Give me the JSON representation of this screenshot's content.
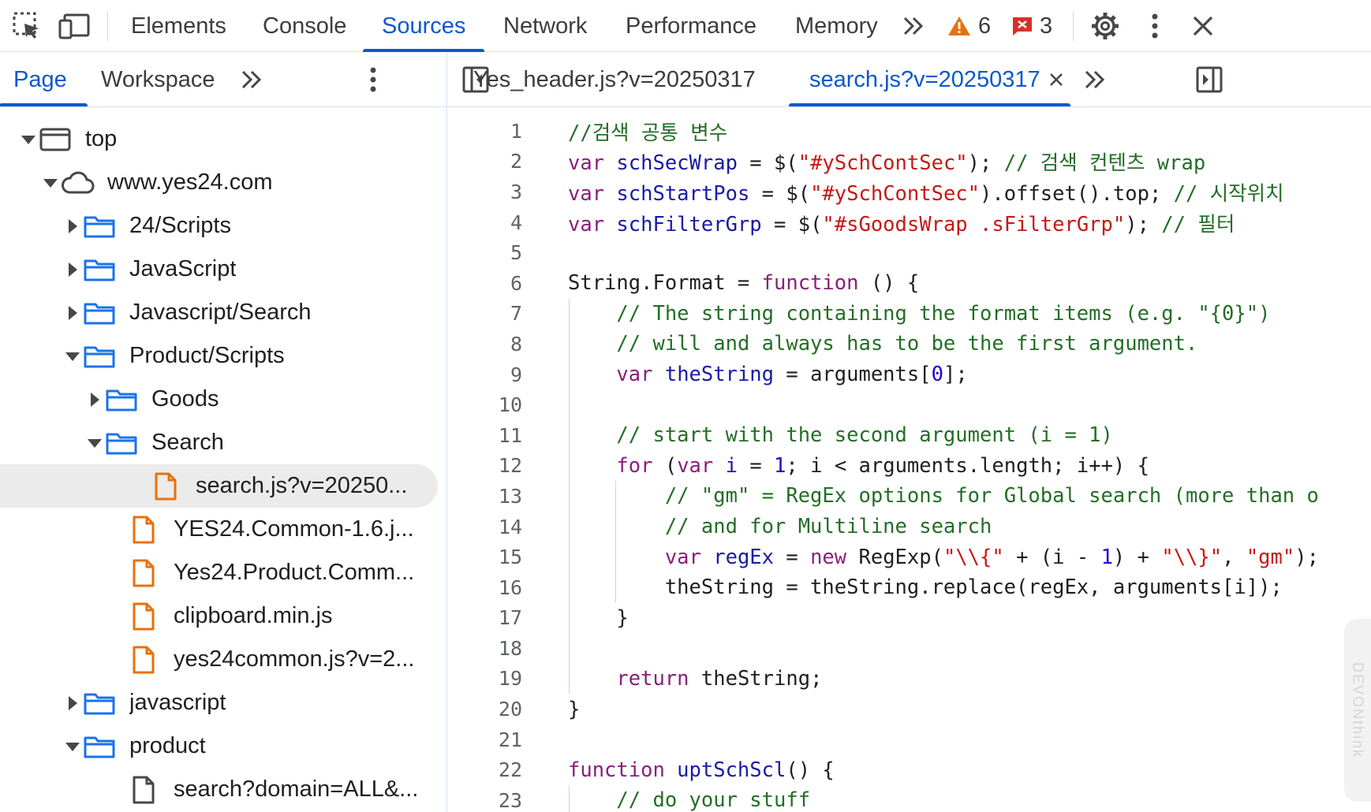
{
  "toolbar": {
    "tabs": [
      {
        "label": "Elements"
      },
      {
        "label": "Console"
      },
      {
        "label": "Sources",
        "active": true
      },
      {
        "label": "Network"
      },
      {
        "label": "Performance"
      },
      {
        "label": "Memory"
      }
    ],
    "warnings_count": "6",
    "errors_count": "3",
    "more_tabs_icon": "chevrons-right-icon",
    "colors": {
      "accent": "#0b57d0",
      "warning": "#e8710a",
      "error": "#d93025"
    }
  },
  "navigator": {
    "tabs": [
      {
        "label": "Page",
        "active": true
      },
      {
        "label": "Workspace"
      }
    ],
    "tree": [
      {
        "label": "top",
        "icon": "frame-icon",
        "expanded": true
      },
      {
        "label": "www.yes24.com",
        "icon": "cloud-icon",
        "expanded": true
      },
      {
        "label": "24/Scripts",
        "icon": "folder-icon",
        "expanded": false
      },
      {
        "label": "JavaScript",
        "icon": "folder-icon",
        "expanded": false
      },
      {
        "label": "Javascript/Search",
        "icon": "folder-icon",
        "expanded": false
      },
      {
        "label": "Product/Scripts",
        "icon": "folder-icon",
        "expanded": true
      },
      {
        "label": "Goods",
        "icon": "folder-icon",
        "expanded": false
      },
      {
        "label": "Search",
        "icon": "folder-icon",
        "expanded": true
      },
      {
        "label": "search.js?v=20250...",
        "icon": "script-file-icon",
        "selected": true
      },
      {
        "label": "YES24.Common-1.6.j...",
        "icon": "script-file-icon"
      },
      {
        "label": "Yes24.Product.Comm...",
        "icon": "script-file-icon"
      },
      {
        "label": "clipboard.min.js",
        "icon": "script-file-icon"
      },
      {
        "label": "yes24common.js?v=2...",
        "icon": "script-file-icon"
      },
      {
        "label": "javascript",
        "icon": "folder-icon",
        "expanded": false
      },
      {
        "label": "product",
        "icon": "folder-icon",
        "expanded": true
      },
      {
        "label": "search?domain=ALL&...",
        "icon": "document-file-icon"
      }
    ]
  },
  "editor": {
    "tabs": [
      {
        "label": "Yes_header.js?v=20250317"
      },
      {
        "label": "search.js?v=20250317",
        "active": true
      }
    ],
    "side_hint": "DEVONthink",
    "lines": [
      {
        "n": "1"
      },
      {
        "n": "2"
      },
      {
        "n": "3"
      },
      {
        "n": "4"
      },
      {
        "n": "5"
      },
      {
        "n": "6"
      },
      {
        "n": "7"
      },
      {
        "n": "8"
      },
      {
        "n": "9"
      },
      {
        "n": "10"
      },
      {
        "n": "11"
      },
      {
        "n": "12"
      },
      {
        "n": "13"
      },
      {
        "n": "14"
      },
      {
        "n": "15"
      },
      {
        "n": "16"
      },
      {
        "n": "17"
      },
      {
        "n": "18"
      },
      {
        "n": "19"
      },
      {
        "n": "20"
      },
      {
        "n": "21"
      },
      {
        "n": "22"
      },
      {
        "n": "23"
      }
    ],
    "code": [
      [
        [
          "cm",
          "//검색 공통 변수"
        ]
      ],
      [
        [
          "kw",
          "var "
        ],
        [
          "vr",
          "schSecWrap"
        ],
        [
          "",
          " = $("
        ],
        [
          "st",
          "\"#ySchContSec\""
        ],
        [
          "",
          "); "
        ],
        [
          "cm",
          "// 검색 컨텐츠 wrap"
        ]
      ],
      [
        [
          "kw",
          "var "
        ],
        [
          "vr",
          "schStartPos"
        ],
        [
          "",
          " = $("
        ],
        [
          "st",
          "\"#ySchContSec\""
        ],
        [
          "",
          ").offset().top; "
        ],
        [
          "cm",
          "// 시작위치"
        ]
      ],
      [
        [
          "kw",
          "var "
        ],
        [
          "vr",
          "schFilterGrp"
        ],
        [
          "",
          " = $("
        ],
        [
          "st",
          "\"#sGoodsWrap .sFilterGrp\""
        ],
        [
          "",
          "); "
        ],
        [
          "cm",
          "// 필터"
        ]
      ],
      [],
      [
        [
          "",
          "String.Format = "
        ],
        [
          "kw",
          "function"
        ],
        [
          "",
          " () {"
        ]
      ],
      [
        [
          "",
          "    "
        ],
        [
          "cm",
          "// The string containing the format items (e.g. \"{0}\")"
        ]
      ],
      [
        [
          "",
          "    "
        ],
        [
          "cm",
          "// will and always has to be the first argument."
        ]
      ],
      [
        [
          "",
          "    "
        ],
        [
          "kw",
          "var "
        ],
        [
          "vr",
          "theString"
        ],
        [
          "",
          " = arguments["
        ],
        [
          "nm",
          "0"
        ],
        [
          "",
          "];"
        ]
      ],
      [],
      [
        [
          "",
          "    "
        ],
        [
          "cm",
          "// start with the second argument (i = 1)"
        ]
      ],
      [
        [
          "",
          "    "
        ],
        [
          "kw",
          "for"
        ],
        [
          "",
          " ("
        ],
        [
          "kw",
          "var "
        ],
        [
          "vr",
          "i"
        ],
        [
          "",
          " = "
        ],
        [
          "nm",
          "1"
        ],
        [
          "",
          "; i < arguments.length; i++) {"
        ]
      ],
      [
        [
          "",
          "        "
        ],
        [
          "cm",
          "// \"gm\" = RegEx options for Global search (more than o"
        ]
      ],
      [
        [
          "",
          "        "
        ],
        [
          "cm",
          "// and for Multiline search"
        ]
      ],
      [
        [
          "",
          "        "
        ],
        [
          "kw",
          "var "
        ],
        [
          "vr",
          "regEx"
        ],
        [
          "",
          " = "
        ],
        [
          "kw",
          "new"
        ],
        [
          "",
          " RegExp("
        ],
        [
          "st",
          "\"\\\\{\""
        ],
        [
          "",
          " + (i - "
        ],
        [
          "nm",
          "1"
        ],
        [
          "",
          ") + "
        ],
        [
          "st",
          "\"\\\\}\""
        ],
        [
          "",
          ", "
        ],
        [
          "st",
          "\"gm\""
        ],
        [
          "",
          ");"
        ]
      ],
      [
        [
          "",
          "        theString = theString.replace(regEx, arguments[i]);"
        ]
      ],
      [
        [
          "",
          "    }"
        ]
      ],
      [],
      [
        [
          "",
          "    "
        ],
        [
          "kw",
          "return"
        ],
        [
          "",
          " theString;"
        ]
      ],
      [
        [
          "",
          "}"
        ]
      ],
      [],
      [
        [
          "kw",
          "function "
        ],
        [
          "fn",
          "uptSchScl"
        ],
        [
          "",
          "() {"
        ]
      ],
      [
        [
          "",
          "    "
        ],
        [
          "cm",
          "// do your stuff"
        ]
      ]
    ]
  }
}
